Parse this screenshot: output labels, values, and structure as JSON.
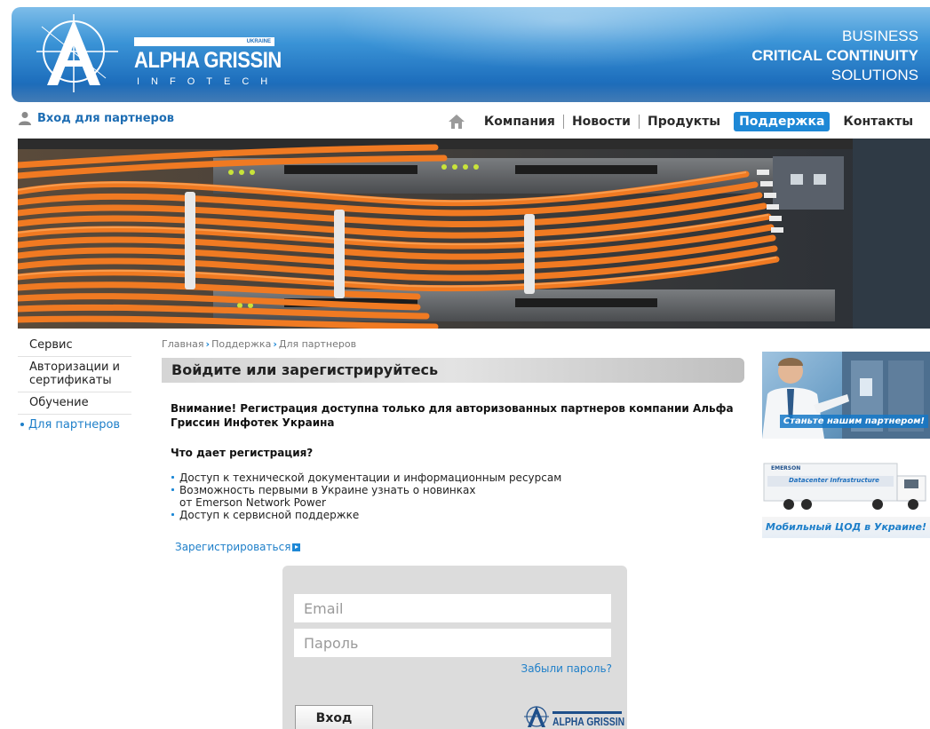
{
  "header": {
    "logo": {
      "name": "ALPHA GRISSIN",
      "sub": "INFOTECH",
      "country": "UKRAINE"
    },
    "tagline": {
      "line1": "BUSINESS",
      "line2": "CRITICAL CONTINUITY",
      "line3": "SOLUTIONS"
    }
  },
  "partner_login": {
    "label": "Вход для партнеров",
    "icon": "user-icon"
  },
  "nav": {
    "home_icon": "home-icon",
    "items": [
      {
        "label": "Компания"
      },
      {
        "label": "Новости"
      },
      {
        "label": "Продукты"
      },
      {
        "label": "Поддержка",
        "active": true
      },
      {
        "label": "Контакты"
      }
    ]
  },
  "sidebar": {
    "items": [
      {
        "label": "Сервис"
      },
      {
        "label": "Авторизации и сертификаты"
      },
      {
        "label": "Обучение"
      },
      {
        "label": "Для партнеров",
        "current": true
      }
    ]
  },
  "breadcrumb": {
    "items": [
      "Главная",
      "Поддержка",
      "Для партнеров"
    ]
  },
  "main": {
    "heading": "Войдите или зарегистрируйтесь",
    "notice": "Внимание! Регистрация доступна только для авторизованных партнеров компании Альфа Гриссин Инфотек Украина",
    "what_title": "Что дает регистрация?",
    "benefits": [
      {
        "line1": "Доступ к технической документации и информационным ресурсам",
        "line2": ""
      },
      {
        "line1": "Возможность первыми в Украине узнать о новинках",
        "line2": "от Emerson Network Power"
      },
      {
        "line1": "Доступ к сервисной поддержке",
        "line2": ""
      }
    ],
    "register_link": "Зарегистрироваться"
  },
  "login": {
    "email_placeholder": "Email",
    "email_value": "",
    "password_placeholder": "Пароль",
    "password_value": "",
    "forgot": "Забыли пароль?",
    "submit": "Вход",
    "mini_logo_text": "ALPHA GRISSIN"
  },
  "ads": {
    "ad1_caption": "Станьте нашим партнером!",
    "ad2_truck_text": "Datacenter Infrastructure",
    "ad2_brand": "EMERSON",
    "ad2_caption": "Мобильный ЦОД  в Украине!"
  },
  "colors": {
    "brand_blue": "#1e6fbd",
    "link_blue": "#1e7fc9",
    "active_nav": "#1e88d6"
  }
}
